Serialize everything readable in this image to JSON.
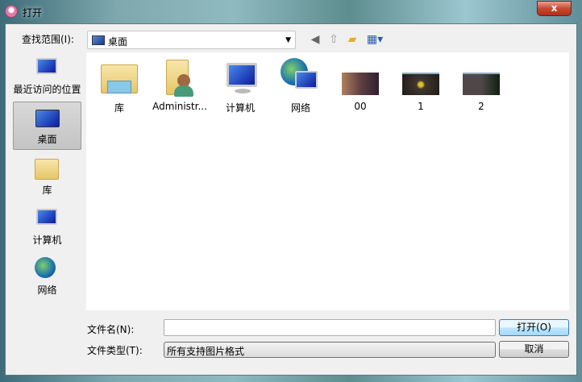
{
  "window": {
    "title": "打开",
    "close_label": "x"
  },
  "toolbar": {
    "lookin_label": "查找范围(I):",
    "lookin_value": "桌面",
    "icons": [
      "back-icon",
      "up-folder-icon",
      "new-folder-icon",
      "view-menu-icon"
    ]
  },
  "sidebar": {
    "items": [
      {
        "label": "最近访问的位置"
      },
      {
        "label": "桌面"
      },
      {
        "label": "库"
      },
      {
        "label": "计算机"
      },
      {
        "label": "网络"
      }
    ]
  },
  "files": [
    {
      "label": "库"
    },
    {
      "label": "Administr..."
    },
    {
      "label": "计算机"
    },
    {
      "label": "网络"
    },
    {
      "label": "00"
    },
    {
      "label": "1"
    },
    {
      "label": "2"
    }
  ],
  "footer": {
    "filename_label": "文件名(N):",
    "filename_value": "",
    "filetype_label": "文件类型(T):",
    "filetype_value": "所有支持图片格式",
    "open_label": "打开(O)",
    "cancel_label": "取消"
  }
}
